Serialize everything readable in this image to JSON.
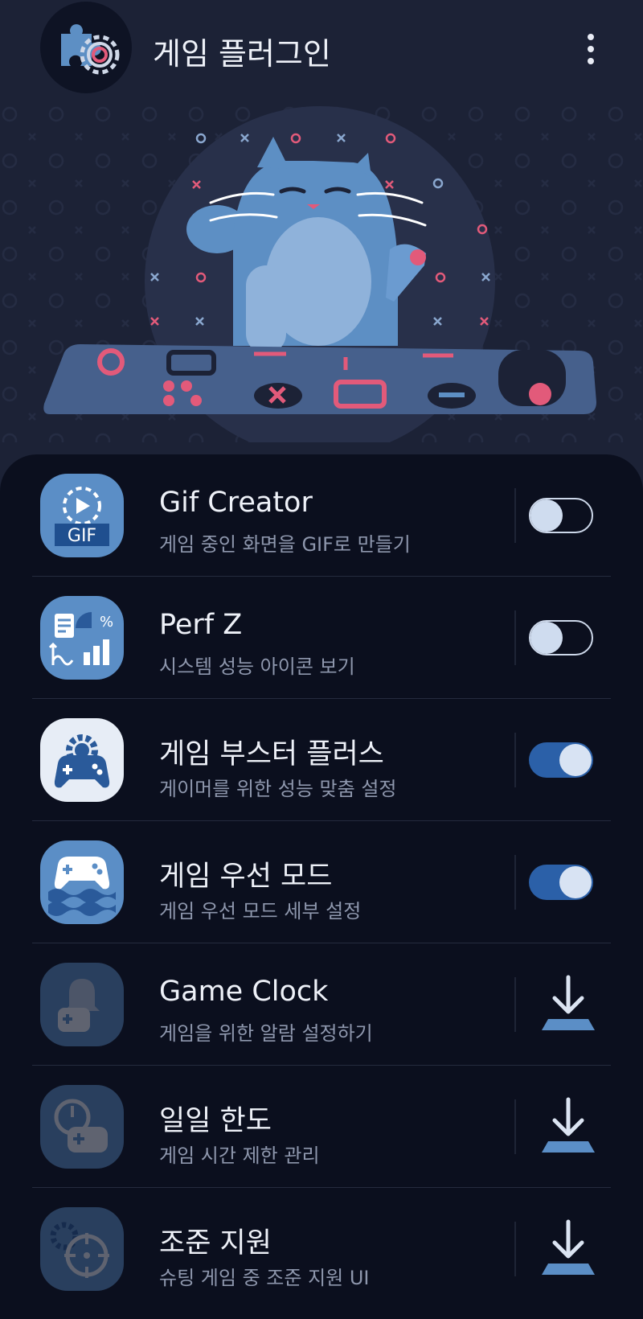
{
  "header": {
    "title": "게임 플러그인",
    "icon": "puzzle-gear-icon",
    "menu_icon": "more-vert-icon"
  },
  "plugins": [
    {
      "title": "Gif Creator",
      "subtitle": "게임 중인 화면을 GIF로 만들기",
      "icon": "gif-creator-icon",
      "icon_text": "GIF",
      "action": "toggle",
      "state": "off"
    },
    {
      "title": "Perf Z",
      "subtitle": "시스템 성능 아이콘 보기",
      "icon": "perf-chart-icon",
      "action": "toggle",
      "state": "off"
    },
    {
      "title": "게임 부스터 플러스",
      "subtitle": "게이머를 위한 성능 맞춤 설정",
      "icon": "gamepad-gear-icon",
      "action": "toggle",
      "state": "on"
    },
    {
      "title": "게임 우선 모드",
      "subtitle": "게임 우선 모드 세부 설정",
      "icon": "gamepad-waves-icon",
      "action": "toggle",
      "state": "on"
    },
    {
      "title": "Game Clock",
      "subtitle": "게임을 위한 알람 설정하기",
      "icon": "bell-gamepad-icon",
      "action": "download"
    },
    {
      "title": "일일 한도",
      "subtitle": "게임 시간 제한 관리",
      "icon": "timer-gamepad-icon",
      "action": "download"
    },
    {
      "title": "조준 지원",
      "subtitle": "슈팅 게임 중 조준 지원 UI",
      "icon": "crosshair-icon",
      "action": "download"
    }
  ],
  "colors": {
    "background": "#1c2236",
    "list_background": "#0b0f1e",
    "accent_blue": "#2b60a8",
    "icon_blue": "#5b8ec6",
    "cat_blue": "#5d8fc4",
    "pink": "#e25a7a"
  }
}
